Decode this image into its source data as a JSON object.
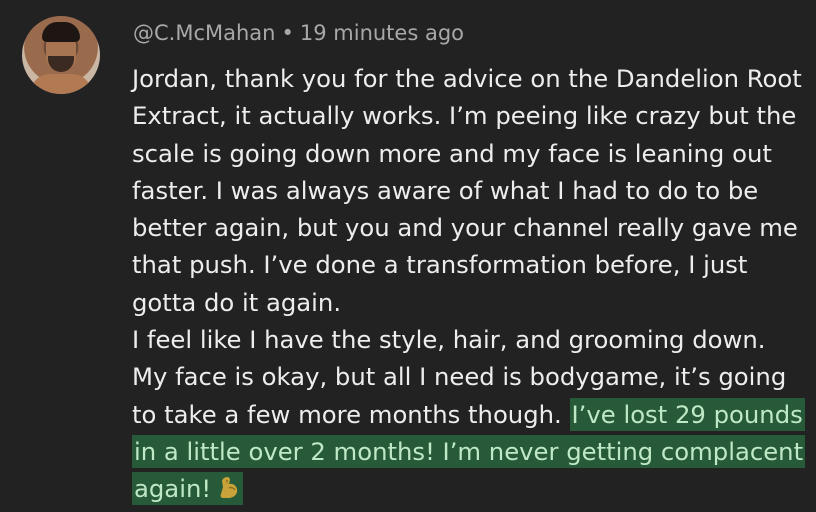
{
  "comment": {
    "author": "@C.McMahan",
    "separator": "•",
    "timestamp": "19 minutes ago",
    "para1": "Jordan, thank you for the advice on the Dandelion Root Extract, it actually works. I’m peeing like crazy but the scale is going down more and my face is leaning out faster. I was always aware of what I had to do to be better again, but you and your channel really gave me that push. I’ve done a transformation before, I just gotta do it again.",
    "para2_plain": "I feel like I have the style, hair, and grooming down. My face is okay, but all I need is bodygame, it’s going to take a few more months though.",
    "para2_highlight": "I’ve lost 29 pounds in a little over 2 months! I’m never getting complacent again!",
    "emoji_icon": "flexed-biceps-icon",
    "highlight_color": "#275a38"
  }
}
